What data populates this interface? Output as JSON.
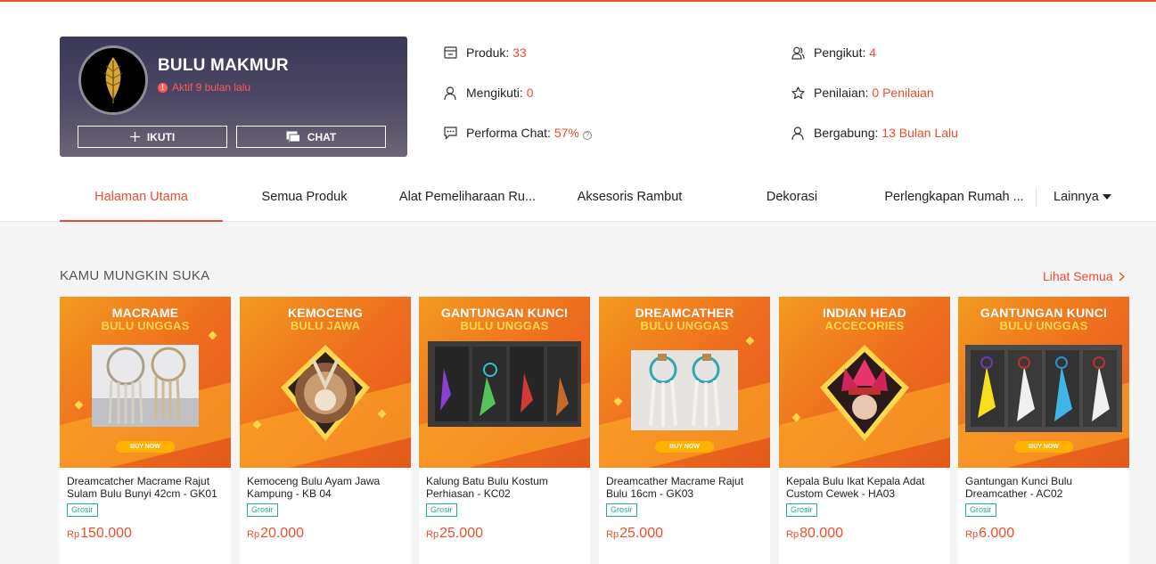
{
  "shop": {
    "name": "BULU MAKMUR",
    "status": "Aktif 9 bulan lalu",
    "follow_label": "IKUTI",
    "chat_label": "CHAT"
  },
  "stats": {
    "products_label": "Produk:",
    "products_value": "33",
    "following_label": "Mengikuti:",
    "following_value": "0",
    "chat_perf_label": "Performa Chat:",
    "chat_perf_value": "57%",
    "followers_label": "Pengikut:",
    "followers_value": "4",
    "rating_label": "Penilaian:",
    "rating_value": "0 Penilaian",
    "joined_label": "Bergabung:",
    "joined_value": "13 Bulan Lalu"
  },
  "tabs": [
    {
      "label": "Halaman Utama"
    },
    {
      "label": "Semua Produk"
    },
    {
      "label": "Alat Pemeliharaan Ru..."
    },
    {
      "label": "Aksesoris Rambut"
    },
    {
      "label": "Dekorasi"
    },
    {
      "label": "Perlengkapan Rumah ..."
    }
  ],
  "more_tab": "Lainnya",
  "section": {
    "title": "KAMU MUNGKIN SUKA",
    "see_all": "Lihat Semua"
  },
  "products": [
    {
      "banner_line1": "MACRAME",
      "banner_line2": "BULU UNGGAS",
      "buy": "BUY NOW",
      "name": "Dreamcatcher Macrame Rajut Sulam Bulu Bunyi 42cm - GK01",
      "badge": "Grosir",
      "currency": "Rp",
      "price": "150.000"
    },
    {
      "banner_line1": "KEMOCENG",
      "banner_line2": "BULU JAWA",
      "buy": "",
      "name": "Kemoceng Bulu Ayam Jawa Kampung - KB 04",
      "badge": "Grosir",
      "currency": "Rp",
      "price": "20.000"
    },
    {
      "banner_line1": "GANTUNGAN KUNCI",
      "banner_line2": "BULU UNGGAS",
      "buy": "",
      "name": "Kalung Batu Bulu Kostum Perhiasan - KC02",
      "badge": "Grosir",
      "currency": "Rp",
      "price": "25.000"
    },
    {
      "banner_line1": "DREAMCATHER",
      "banner_line2": "BULU UNGGAS",
      "buy": "BUY NOW",
      "name": "Dreamcather Macrame Rajut Bulu 16cm - GK03",
      "badge": "Grosir",
      "currency": "Rp",
      "price": "25.000"
    },
    {
      "banner_line1": "INDIAN HEAD",
      "banner_line2": "ACCECORIES",
      "buy": "",
      "name": "Kepala Bulu Ikat Kepala Adat Custom Cewek - HA03",
      "badge": "Grosir",
      "currency": "Rp",
      "price": "80.000"
    },
    {
      "banner_line1": "GANTUNGAN KUNCI",
      "banner_line2": "BULU UNGGAS",
      "buy": "BUY NOW",
      "name": "Gantungan Kunci Bulu Dreamcather - AC02",
      "badge": "Grosir",
      "currency": "Rp",
      "price": "6.000"
    }
  ]
}
